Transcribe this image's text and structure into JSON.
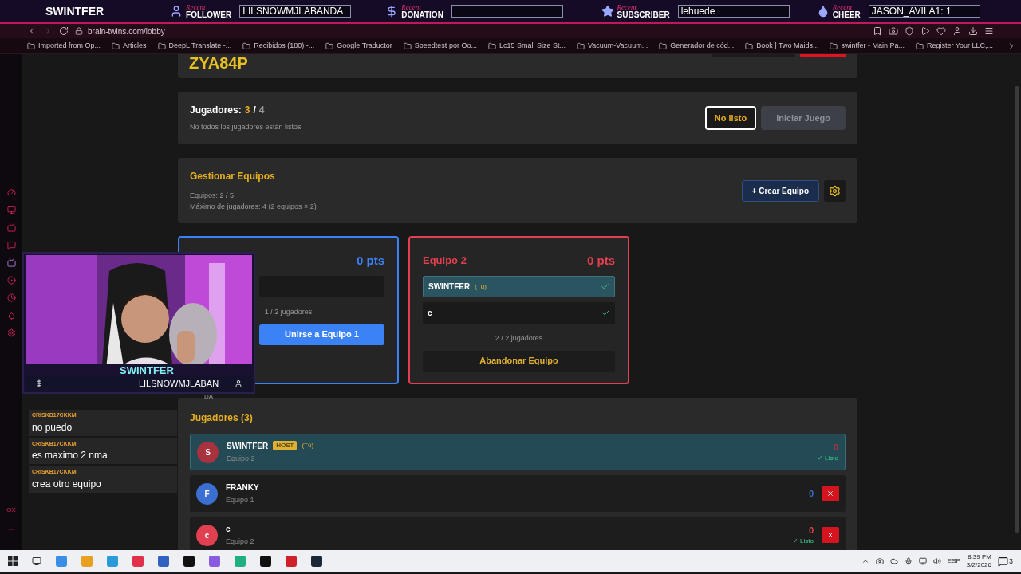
{
  "stream_bar": {
    "channel": "SWINTFER",
    "alerts": [
      {
        "kind": "follower",
        "tag": "Recent",
        "label": "FOLLOWER",
        "value": "LILSNOWMJLABANDA"
      },
      {
        "kind": "donation",
        "tag": "Recent",
        "label": "DONATION"
      },
      {
        "kind": "subscriber",
        "tag": "Recent",
        "label": "SUBSCRIBER",
        "value": "lehuede"
      },
      {
        "kind": "cheer",
        "tag": "Recent",
        "label": "CHEER",
        "value": "JASON_AVILA1: 1"
      }
    ]
  },
  "browser": {
    "url": "brain-twins.com/lobby",
    "bookmarks": [
      "Imported from Op...",
      "Articles",
      "DeepL Translate -...",
      "Recibidos (180) -...",
      "Google Traductor",
      "Speedtest por Oo...",
      "Lc15 Small Size St...",
      "Vacuum-Vacuum...",
      "Generador de cód...",
      "Book | Two Maids...",
      "swintfer - Main Pa...",
      "Register Your LLC,..."
    ]
  },
  "lobby": {
    "code": "ZYA84P",
    "summary": {
      "label": "Jugadores:",
      "current": "3",
      "separator": "/",
      "max": "4",
      "note": "No todos los jugadores están listos"
    },
    "buttons": [
      {
        "label": "No listo",
        "kind": "ready",
        "disabled": false
      },
      {
        "label": "Iniciar Juego",
        "kind": "start",
        "disabled": true
      }
    ]
  },
  "team_manager": {
    "title": "Gestionar Equipos",
    "teams_count": "Equipos: 2 / 5",
    "max_players": "Máximo de jugadores: 4 (2 equipos × 2)",
    "create_button": "+ Crear Equipo"
  },
  "teams": [
    {
      "score": "0 pts",
      "color": "#3b82f6",
      "slots": [
        {
          "ready": false
        }
      ],
      "count": "1 / 2 jugadores",
      "action": {
        "label": "Unirse a Equipo 1",
        "kind": "join"
      }
    },
    {
      "title": "Equipo 2",
      "score": "0 pts",
      "color": "#e0404f",
      "slots": [
        {
          "name": "SWINTFER",
          "you_label": "(Tú)",
          "ready": true,
          "selected": true
        },
        {
          "name": "c",
          "ready": true,
          "selected": false
        }
      ],
      "count": "2 / 2 jugadores",
      "action": {
        "label": "Abandonar Equipo",
        "kind": "leave"
      }
    }
  ],
  "players_section": {
    "title": "Jugadores (3)",
    "players": [
      {
        "initial": "S",
        "name": "SWINTFER",
        "host_badge": "HOST",
        "you_label": "(Tú)",
        "team": "Equipo 2",
        "score": "0",
        "color": "#a8323e",
        "ready_label": "✓ Listo",
        "kickable": false,
        "selected": true
      },
      {
        "initial": "F",
        "name": "FRANKY",
        "team": "Equipo 1",
        "score": "0",
        "color": "#3b6fd1",
        "kickable": true,
        "selected": false
      },
      {
        "initial": "c",
        "name": "c",
        "team": "Equipo 2",
        "score": "0",
        "color": "#e0404f",
        "ready_label": "✓ Listo",
        "kickable": true,
        "selected": false
      }
    ]
  },
  "webcam": {
    "kind": "picture",
    "caption": "SWINTFER",
    "name_bar": "LILSNOWMJLABAN",
    "overflow": "DA"
  },
  "chat": [
    {
      "user": "CRISKB17CKKM",
      "text": "no puedo"
    },
    {
      "user": "CRISKB17CKKM",
      "text": "es maximo 2 nma"
    },
    {
      "user": "CRISKB17CKKM",
      "text": "crea otro equipo"
    }
  ],
  "sidebar_extra": {
    "label": "GX",
    "more": "..."
  },
  "taskbar": {
    "language": "ESP",
    "time": "8:39 PM",
    "date": "3/2/2026",
    "notifications": "3"
  }
}
